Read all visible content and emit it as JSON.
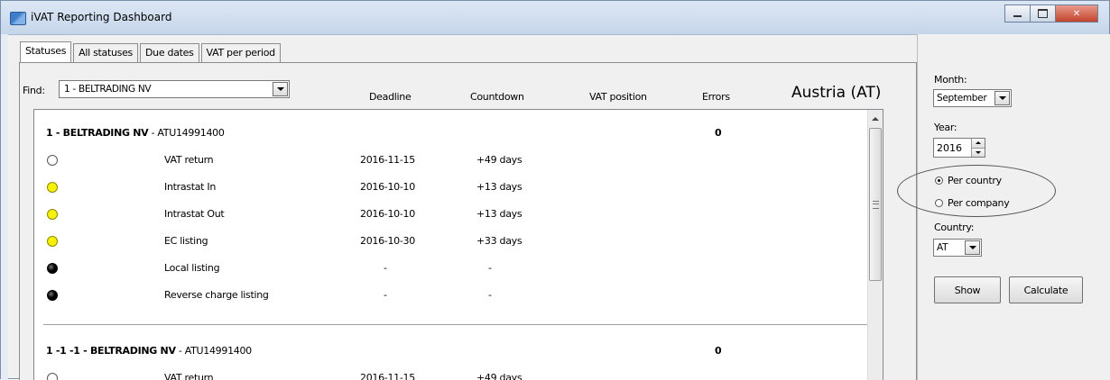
{
  "window": {
    "title": "iVAT Reporting Dashboard"
  },
  "tabs": [
    {
      "label": "Statuses",
      "active": true
    },
    {
      "label": "All statuses",
      "active": false
    },
    {
      "label": "Due dates",
      "active": false
    },
    {
      "label": "VAT per period",
      "active": false
    }
  ],
  "find": {
    "label": "Find:",
    "value": "1 - BELTRADING NV"
  },
  "columns": {
    "deadline": "Deadline",
    "countdown": "Countdown",
    "vat_position": "VAT position",
    "errors": "Errors"
  },
  "country_title": "Austria (AT)",
  "companies": [
    {
      "name": "1 - BELTRADING NV",
      "vat": " - ATU14991400",
      "errors": "0",
      "rows": [
        {
          "status": "white",
          "name": "VAT return",
          "date": "2016-11-15",
          "countdown": "+49 days"
        },
        {
          "status": "yellow",
          "name": "Intrastat In",
          "date": "2016-10-10",
          "countdown": "+13 days"
        },
        {
          "status": "yellow",
          "name": "Intrastat Out",
          "date": "2016-10-10",
          "countdown": "+13 days"
        },
        {
          "status": "yellow",
          "name": "EC listing",
          "date": "2016-10-30",
          "countdown": "+33 days"
        },
        {
          "status": "black",
          "name": "Local listing",
          "date": "-",
          "countdown": "-"
        },
        {
          "status": "black",
          "name": "Reverse charge listing",
          "date": "-",
          "countdown": "-"
        }
      ]
    },
    {
      "name": "1 -1 -1 - BELTRADING NV",
      "vat": " - ATU14991400",
      "errors": "0",
      "rows": [
        {
          "status": "white",
          "name": "VAT return",
          "date": "2016-11-15",
          "countdown": "+49 days"
        }
      ]
    }
  ],
  "sidepanel": {
    "month_label": "Month:",
    "month_value": "September",
    "year_label": "Year:",
    "year_value": "2016",
    "per_country": "Per country",
    "per_company": "Per company",
    "selected_mode": "country",
    "country_label": "Country:",
    "country_value": "AT",
    "show_button": "Show",
    "calculate_button": "Calculate"
  },
  "colors": {
    "status_yellow": "#f7f300",
    "status_black": "#000000",
    "status_white": "#ffffff"
  }
}
